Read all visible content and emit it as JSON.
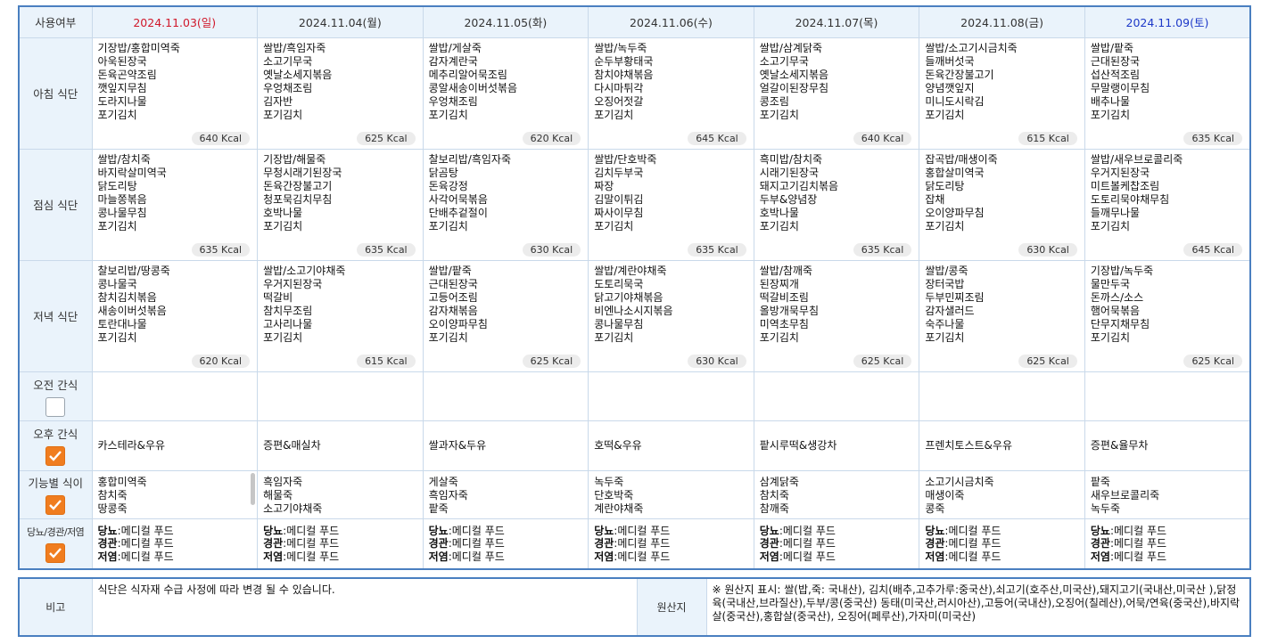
{
  "header": {
    "use_label": "사용여부",
    "days": [
      "2024.11.03(일)",
      "2024.11.04(월)",
      "2024.11.05(화)",
      "2024.11.06(수)",
      "2024.11.07(목)",
      "2024.11.08(금)",
      "2024.11.09(토)"
    ]
  },
  "rows": {
    "breakfast_label": "아침 식단",
    "lunch_label": "점심 식단",
    "dinner_label": "저녁 식단",
    "am_snack_label": "오전 간식",
    "pm_snack_label": "오후 간식",
    "func_label": "기능별 식이",
    "diet_label": "당뇨/경관/저염"
  },
  "checkboxes": {
    "am_snack": false,
    "pm_snack": true,
    "func": true,
    "diet": true
  },
  "breakfast": [
    {
      "items": [
        "기장밥/홍합미역죽",
        "아욱된장국",
        "돈육곤약조림",
        "깻잎지무침",
        "도라지나물",
        "포기김치"
      ],
      "kcal": "640 Kcal"
    },
    {
      "items": [
        "쌀밥/흑임자죽",
        "소고기무국",
        "옛날소세지볶음",
        "우엉채조림",
        "김자반",
        "포기김치"
      ],
      "kcal": "625 Kcal"
    },
    {
      "items": [
        "쌀밥/게살죽",
        "감자계란국",
        "메추리알어묵조림",
        "콩알새송이버섯볶음",
        "우엉채조림",
        "포기김치"
      ],
      "kcal": "620 Kcal"
    },
    {
      "items": [
        "쌀밥/녹두죽",
        "순두부황태국",
        "참치야채볶음",
        "다시마튀각",
        "오징어젓갈",
        "포기김치"
      ],
      "kcal": "645 Kcal"
    },
    {
      "items": [
        "쌀밥/삼계닭죽",
        "소고기무국",
        "옛날소세지볶음",
        "얼갈이된장무침",
        "콩조림",
        "포기김치"
      ],
      "kcal": "640 Kcal"
    },
    {
      "items": [
        "쌀밥/소고기시금치죽",
        "들깨버섯국",
        "돈육간장불고기",
        "양념깻잎지",
        "미니도시락김",
        "포기김치"
      ],
      "kcal": "615 Kcal"
    },
    {
      "items": [
        "쌀밥/팥죽",
        "근대된장국",
        "섭산적조림",
        "무말랭이무침",
        "배추나물",
        "포기김치"
      ],
      "kcal": "635 Kcal"
    }
  ],
  "lunch": [
    {
      "items": [
        "쌀밥/참치죽",
        "바지락살미역국",
        "닭도리탕",
        "마늘쫑볶음",
        "콩나물무침",
        "포기김치"
      ],
      "kcal": "635 Kcal"
    },
    {
      "items": [
        "기장밥/해물죽",
        "무청시래기된장국",
        "돈육간장불고기",
        "청포묵김치무침",
        "호박나물",
        "포기김치"
      ],
      "kcal": "635 Kcal"
    },
    {
      "items": [
        "찰보리밥/흑임자죽",
        "닭곰탕",
        "돈육강정",
        "사각어묵볶음",
        "단배추겉절이",
        "포기김치"
      ],
      "kcal": "630 Kcal"
    },
    {
      "items": [
        "쌀밥/단호박죽",
        "김치두부국",
        "짜장",
        "김말이튀김",
        "짜사이무침",
        "포기김치"
      ],
      "kcal": "635 Kcal"
    },
    {
      "items": [
        "흑미밥/참치죽",
        "시래기된장국",
        "돼지고기김치볶음",
        "두부&양념장",
        "호박나물",
        "포기김치"
      ],
      "kcal": "635 Kcal"
    },
    {
      "items": [
        "잡곡밥/매생이죽",
        "홍합살미역국",
        "닭도리탕",
        "잡채",
        "오이양파무침",
        "포기김치"
      ],
      "kcal": "630 Kcal"
    },
    {
      "items": [
        "쌀밥/새우브로콜리죽",
        "우거지된장국",
        "미트볼케찹조림",
        "도토리묵야채무침",
        "들깨무나물",
        "포기김치"
      ],
      "kcal": "645 Kcal"
    }
  ],
  "dinner": [
    {
      "items": [
        "찰보리밥/땅콩죽",
        "콩나물국",
        "참치김치볶음",
        "새송이버섯볶음",
        "토란대나물",
        "포기김치"
      ],
      "kcal": "620 Kcal"
    },
    {
      "items": [
        "쌀밥/소고기야채죽",
        "우거지된장국",
        "떡갈비",
        "참치무조림",
        "고사리나물",
        "포기김치"
      ],
      "kcal": "615 Kcal"
    },
    {
      "items": [
        "쌀밥/팥죽",
        "근대된장국",
        "고등어조림",
        "감자채볶음",
        "오이양파무침",
        "포기김치"
      ],
      "kcal": "625 Kcal"
    },
    {
      "items": [
        "쌀밥/계란야채죽",
        "도토리묵국",
        "닭고기야채볶음",
        "비엔나소시지볶음",
        "콩나물무침",
        "포기김치"
      ],
      "kcal": "630 Kcal"
    },
    {
      "items": [
        "쌀밥/참깨죽",
        "된장찌개",
        "떡갈비조림",
        "올방개묵무침",
        "미역초무침",
        "포기김치"
      ],
      "kcal": "625 Kcal"
    },
    {
      "items": [
        "쌀밥/콩죽",
        "장터국밥",
        "두부민찌조림",
        "감자샐러드",
        "숙주나물",
        "포기김치"
      ],
      "kcal": "625 Kcal"
    },
    {
      "items": [
        "기장밥/녹두죽",
        "물만두국",
        "돈까스/소스",
        "햄어묵볶음",
        "단무지채무침",
        "포기김치"
      ],
      "kcal": "625 Kcal"
    }
  ],
  "pm_snack": [
    "카스테라&우유",
    "증편&매실차",
    "쌀과자&두유",
    "호떡&우유",
    "팥시루떡&생강차",
    "프렌치토스트&우유",
    "증편&율무차"
  ],
  "func": [
    [
      "홍합미역죽",
      "참치죽",
      "땅콩죽"
    ],
    [
      "흑임자죽",
      "해물죽",
      "소고기야채죽"
    ],
    [
      "게살죽",
      "흑임자죽",
      "팥죽"
    ],
    [
      "녹두죽",
      "단호박죽",
      "계란야채죽"
    ],
    [
      "삼계닭죽",
      "참치죽",
      "참깨죽"
    ],
    [
      "소고기시금치죽",
      "매생이죽",
      "콩죽"
    ],
    [
      "팥죽",
      "새우브로콜리죽",
      "녹두죽"
    ]
  ],
  "diet": {
    "k1": "당뇨",
    "v1": ":메디컬 푸드",
    "k2": "경관",
    "v2": ":메디컬 푸드",
    "k3": "저염",
    "v3": ":메디컬 푸드"
  },
  "note": {
    "label": "비고",
    "text": "식단은 식자재 수급 사정에 따라 변경 될 수 있습니다.",
    "origin_label": "원산지",
    "origin_text": "※ 원산지 표시: 쌀(밥,죽: 국내산), 김치(배추,고추가루:중국산),쇠고기(호주산,미국산),돼지고기(국내산,미국산 ),닭정육(국내산,브라질산),두부/콩(중국산) 동태(미국산,러시아산),고등어(국내산),오징어(칠레산),어묵/연육(중국산),바지락살(중국산),홍합살(중국산), 오징어(페루산),가자미(미국산)"
  }
}
